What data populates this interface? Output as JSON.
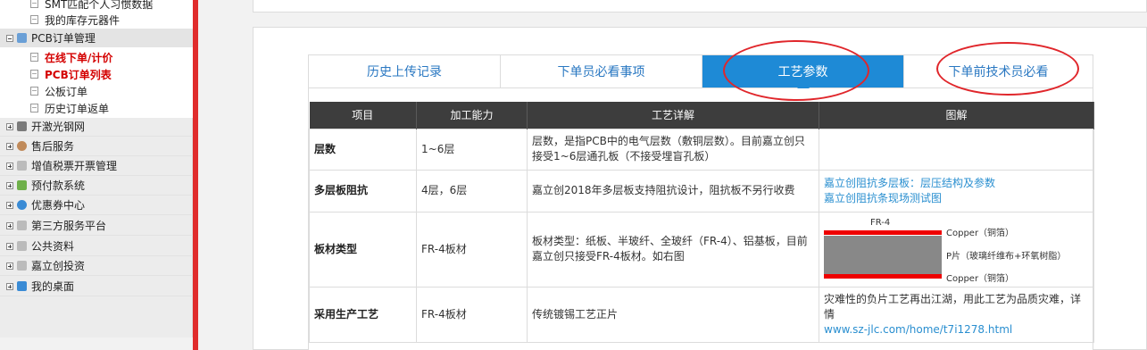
{
  "sidebar": {
    "items": [
      {
        "label": "SMT匹配个人习惯数据",
        "type": "sub"
      },
      {
        "label": "我的库存元器件",
        "type": "sub"
      },
      {
        "label": "PCB订单管理",
        "type": "group-open"
      },
      {
        "label": "在线下单/计价",
        "type": "sub-active"
      },
      {
        "label": "PCB订单列表",
        "type": "sub-active"
      },
      {
        "label": "公板订单",
        "type": "sub"
      },
      {
        "label": "历史订单返单",
        "type": "sub"
      },
      {
        "label": "开激光钢网",
        "type": "group"
      },
      {
        "label": "售后服务",
        "type": "group"
      },
      {
        "label": "增值税票开票管理",
        "type": "group"
      },
      {
        "label": "预付款系统",
        "type": "group"
      },
      {
        "label": "优惠券中心",
        "type": "group"
      },
      {
        "label": "第三方服务平台",
        "type": "group"
      },
      {
        "label": "公共资料",
        "type": "group"
      },
      {
        "label": "嘉立创投资",
        "type": "group"
      },
      {
        "label": "我的桌面",
        "type": "group"
      }
    ]
  },
  "tabs": [
    {
      "label": "历史上传记录"
    },
    {
      "label": "下单员必看事项"
    },
    {
      "label": "工艺参数",
      "active": true
    },
    {
      "label": "下单前技术员必看"
    }
  ],
  "table": {
    "headers": [
      "项目",
      "加工能力",
      "工艺详解",
      "图解"
    ],
    "rows": [
      {
        "name": "层数",
        "capability": "1~6层",
        "detail": "层数，是指PCB中的电气层数（敷铜层数）。目前嘉立创只接受1~6层通孔板（不接受埋盲孔板）"
      },
      {
        "name": "多层板阻抗",
        "capability": "4层，6层",
        "detail": "嘉立创2018年多层板支持阻抗设计，阻抗板不另行收费",
        "links": [
          "嘉立创阻抗多层板：层压结构及参数",
          "嘉立创阻抗条现场测试图"
        ]
      },
      {
        "name": "板材类型",
        "capability": "FR-4板材",
        "detail": "板材类型：纸板、半玻纤、全玻纤（FR-4）、铝基板，目前嘉立创只接受FR-4板材。如右图",
        "figure": {
          "title": "FR-4",
          "top_label": "Copper（铜箔）",
          "mid_label": "P片（玻璃纤维布+环氧树脂）",
          "bottom_label": "Copper（铜箔）"
        }
      },
      {
        "name": "采用生产工艺",
        "capability": "FR-4板材",
        "detail": "传统镀锡工艺正片",
        "note": "灾难性的负片工艺再出江湖，用此工艺为品质灾难，详情",
        "url": "www.sz-jlc.com/home/t7i1278.html"
      }
    ]
  },
  "colors": {
    "accent": "#1e8ad6",
    "highlight_circle": "#e0262b",
    "header_bg": "#3d3d3d",
    "active_nav": "#d40000"
  }
}
